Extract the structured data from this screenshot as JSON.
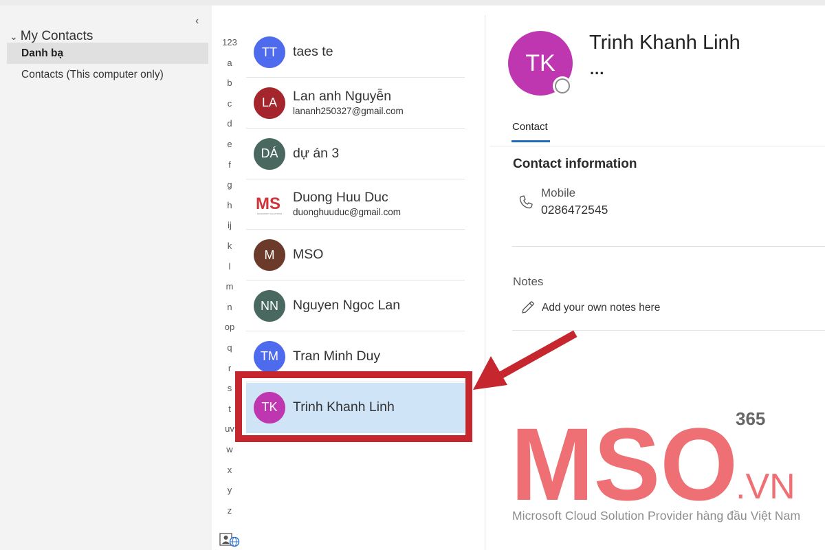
{
  "sidebar": {
    "collapse_glyph": "‹",
    "group_label": "My Contacts",
    "folders": [
      {
        "label": "Danh bạ",
        "selected": true
      },
      {
        "label": "Contacts (This computer only)",
        "selected": false
      }
    ]
  },
  "alphabet": [
    "123",
    "a",
    "b",
    "c",
    "d",
    "e",
    "f",
    "g",
    "h",
    "ij",
    "k",
    "l",
    "m",
    "n",
    "op",
    "q",
    "r",
    "s",
    "t",
    "uv",
    "w",
    "x",
    "y",
    "z"
  ],
  "contacts": [
    {
      "initials": "TT",
      "name": "taes te",
      "email": "",
      "color": "#4f6bed"
    },
    {
      "initials": "LA",
      "name": "Lan anh Nguyễn",
      "email": "lananh250327@gmail.com",
      "color": "#a4262c"
    },
    {
      "initials": "DÁ",
      "name": "dự án 3",
      "email": "",
      "color": "#486860"
    },
    {
      "initials": "",
      "name": "Duong Huu Duc",
      "email": "duonghuuduc@gmail.com",
      "color": "#d13438",
      "logo_text": "MS",
      "logo_sub": "MICROSOFT SOLUTIONS"
    },
    {
      "initials": "M",
      "name": "MSO",
      "email": "",
      "color": "#6b3a2a"
    },
    {
      "initials": "NN",
      "name": "Nguyen Ngoc Lan",
      "email": "",
      "color": "#486860"
    },
    {
      "initials": "TM",
      "name": "Tran Minh Duy",
      "email": "",
      "color": "#4f6bed"
    },
    {
      "initials": "TK",
      "name": "Trinh Khanh Linh",
      "email": "",
      "color": "#bf37b0",
      "selected": true
    }
  ],
  "detail": {
    "initials": "TK",
    "name": "Trinh Khanh Linh",
    "more": "...",
    "tab_label": "Contact",
    "section_title": "Contact information",
    "mobile_label": "Mobile",
    "mobile_value": "0286472545",
    "notes_label": "Notes",
    "notes_placeholder": "Add your own notes here",
    "avatar_color": "#bf37b0"
  },
  "watermark": {
    "logo": "MSO",
    "suffix": "365",
    "domain": ".VN",
    "tagline": "Microsoft Cloud Solution Provider hàng đầu Việt Nam",
    "color": "#ee6f74"
  },
  "annotation_color": "#c6262d",
  "accent_color": "#1f6bb5"
}
